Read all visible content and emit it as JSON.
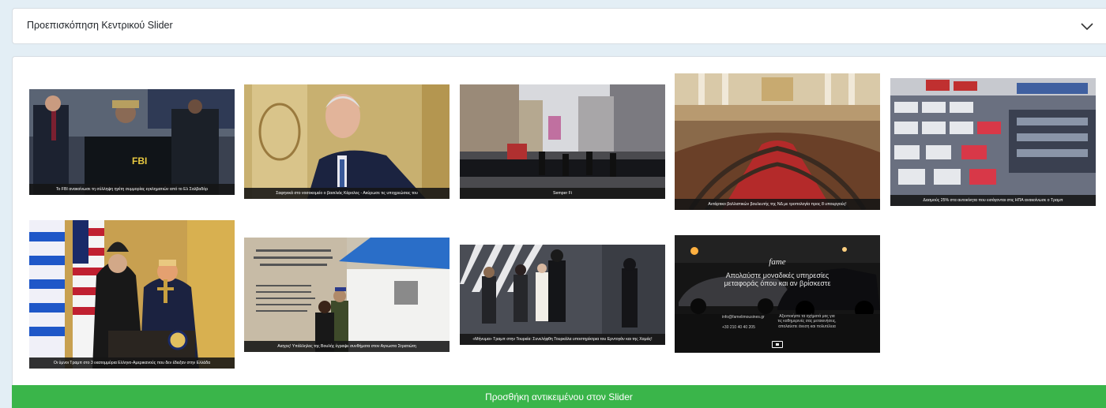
{
  "accordion": {
    "title": "Προεπισκόπηση Κεντρικού Slider",
    "toggle_icon": "chevron-down-icon"
  },
  "slides": [
    {
      "caption": "Το FBI ανακοίνωσε τη σύλληψη ηγέτη συμμορίας εγκληματιών από το Ελ Σαλβαδόρ"
    },
    {
      "caption": "Σαφηνικά στο νοσοκομείο ο βασιλιάς Κάρολος - Ακύρωσε τις υποχρεώσεις του"
    },
    {
      "caption": "Semper Fi"
    },
    {
      "caption": "Αντάρτικο βαλλιστικών βουλευτής της ΝΔ με τροπολογία προς 8 υπουργούς!"
    },
    {
      "caption": "Δασμούς 25% στα αυτοκίνητα που εισάγονται στις ΗΠΑ ανακοίνωσε ο Τραμπ"
    },
    {
      "caption": "Οι ύμνοι Τραμπ στο 3 εκατομμύρια Ελληνο-Αμερικανούς που δεν έδειξαν στην Ελλάδα"
    },
    {
      "caption": "Αισχος! Υπάλληλος της Βουλής έγραψε συνθήματα στον Αγνωστο Στρατιώτη"
    },
    {
      "caption": "«Μήνυμα» Τραμπ στην Τουρκία: Συνελήφθη Τουρκάλα υποστηρίκτρια του Ερντογάν και της Χαμάς!"
    },
    {
      "caption": "",
      "ad": {
        "logo": "fame",
        "headline": "Απολαύστε μοναδικές υπηρεσίες μεταφοράς όπου και αν βρίσκεστε",
        "email": "info@famelimousines.gr",
        "phone": "+30 210 40 40 205",
        "tagline": "Αξιοποιήστε τα οχήματά μας για τις καθημερινές σας μετακινήσεις, απολαύστε άνεση και πολυτέλεια"
      }
    }
  ],
  "add_button": {
    "label": "Προσθήκη αντικειμένου στον Slider"
  }
}
